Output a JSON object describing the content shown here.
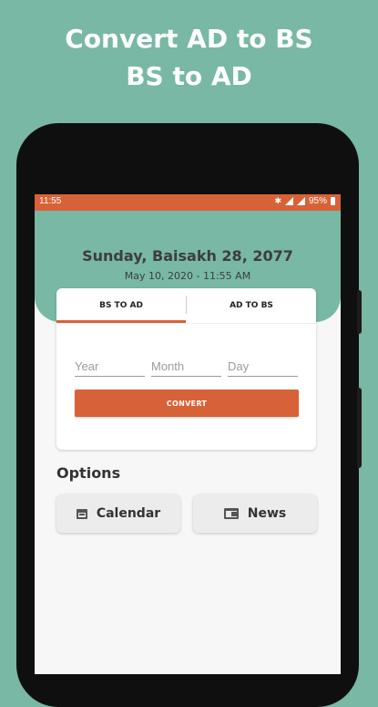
{
  "promo": {
    "line1": "Convert AD to BS",
    "line2": "BS to AD"
  },
  "status_bar": {
    "time": "11:55",
    "battery": "95%",
    "icons": [
      "bluetooth-icon",
      "signal-icon",
      "signal-icon",
      "battery-icon"
    ]
  },
  "header": {
    "date_bs": "Sunday, Baisakh 28, 2077",
    "date_ad": "May 10, 2020 - 11:55 AM"
  },
  "converter": {
    "tabs": [
      {
        "label": "BS TO AD",
        "selected": true
      },
      {
        "label": "AD TO BS",
        "selected": false
      }
    ],
    "fields": {
      "year_placeholder": "Year",
      "month_placeholder": "Month",
      "day_placeholder": "Day"
    },
    "convert_label": "CONVERT"
  },
  "options": {
    "heading": "Options",
    "items": [
      {
        "label": "Calendar",
        "icon": "calendar-icon"
      },
      {
        "label": "News",
        "icon": "news-icon"
      }
    ]
  },
  "colors": {
    "accent": "#d86238",
    "teal": "#78b8a5",
    "background": "#f7f7f7"
  }
}
